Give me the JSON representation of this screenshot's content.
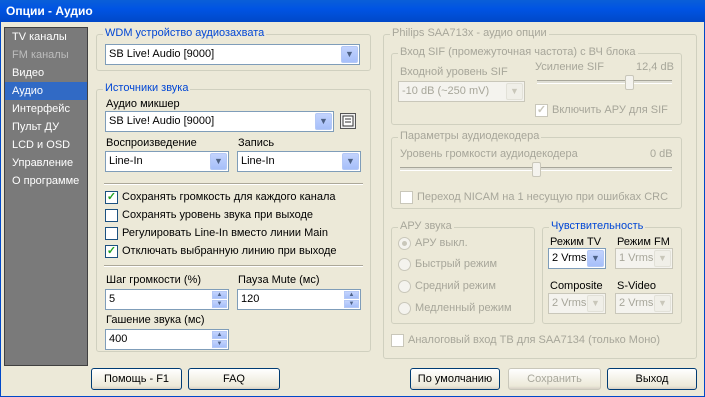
{
  "title": "Опции - Аудио",
  "sidebar": {
    "items": [
      {
        "label": "TV каналы",
        "state": "normal"
      },
      {
        "label": "FM каналы",
        "state": "disabled"
      },
      {
        "label": "Видео",
        "state": "normal"
      },
      {
        "label": "Аудио",
        "state": "selected"
      },
      {
        "label": "Интерфейс",
        "state": "normal"
      },
      {
        "label": "Пульт ДУ",
        "state": "normal"
      },
      {
        "label": "LCD и OSD",
        "state": "normal"
      },
      {
        "label": "Управление",
        "state": "normal"
      },
      {
        "label": "О программе",
        "state": "normal"
      }
    ]
  },
  "wdm": {
    "legend": "WDM устройство аудиозахвата",
    "device": "SB Live! Audio [9000]"
  },
  "sources": {
    "legend": "Источники звука",
    "mixer_label": "Аудио микшер",
    "mixer_value": "SB Live! Audio [9000]",
    "playback_label": "Воспроизведение",
    "playback_value": "Line-In",
    "record_label": "Запись",
    "record_value": "Line-In",
    "checks": [
      {
        "label": "Сохранять громкость для каждого канала",
        "checked": true
      },
      {
        "label": "Сохранять уровень звука при выходе",
        "checked": false
      },
      {
        "label": "Регулировать Line-In вместо линии Main",
        "checked": false
      },
      {
        "label": "Отключать выбранную линию при выходе",
        "checked": true
      }
    ],
    "step_label": "Шаг громкости (%)",
    "step_value": "5",
    "mute_label": "Пауза Mute (мс)",
    "mute_value": "120",
    "fade_label": "Гашение звука (мс)",
    "fade_value": "400"
  },
  "philips": {
    "legend": "Philips SAA713x - аудио опции",
    "sif": {
      "legend": "Вход SIF (промежуточная частота) с ВЧ блока",
      "level_label": "Входной уровень SIF",
      "level_value": "-10 dB (~250 mV)",
      "gain_label": "Усиление SIF",
      "gain_value": "12,4 dB",
      "gain_fraction": 0.7,
      "agc_label": "Включить АРУ для SIF",
      "agc_checked": true
    },
    "decoder": {
      "legend": "Параметры аудиодекодера",
      "volume_label": "Уровень громкости аудиодекодера",
      "volume_value": "0 dB",
      "volume_fraction": 0.5,
      "nicam_label": "Переход NICAM на 1 несущую при ошибках CRC",
      "nicam_checked": false
    },
    "agc": {
      "legend": "АРУ звука",
      "options": [
        {
          "label": "АРУ выкл.",
          "selected": true
        },
        {
          "label": "Быстрый режим",
          "selected": false
        },
        {
          "label": "Средний режим",
          "selected": false
        },
        {
          "label": "Медленный режим",
          "selected": false
        }
      ]
    },
    "sens": {
      "legend": "Чувствительность",
      "tv_label": "Режим TV",
      "tv_value": "2 Vrms",
      "fm_label": "Режим FM",
      "fm_value": "1 Vrms",
      "composite_label": "Composite",
      "composite_value": "2 Vrms",
      "svideo_label": "S-Video",
      "svideo_value": "2 Vrms"
    },
    "analog_label": "Аналоговый вход ТВ для SAA7134 (только Моно)",
    "analog_checked": false
  },
  "buttons": {
    "help": "Помощь - F1",
    "faq": "FAQ",
    "default": "По умолчанию",
    "save": "Сохранить",
    "exit": "Выход"
  }
}
